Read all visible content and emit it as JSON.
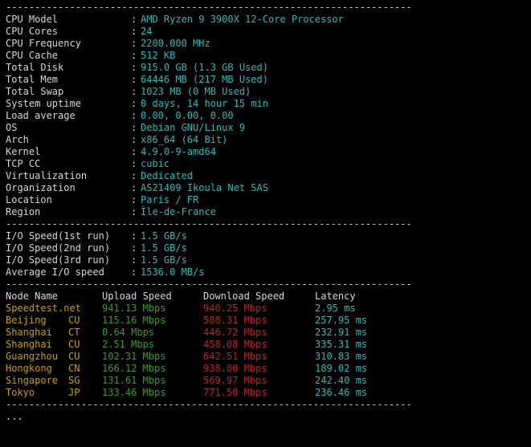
{
  "colors": {
    "label": "#d6d6d6",
    "value": "#2cb9b6",
    "node": "#c9a000",
    "upload": "#3b9a28",
    "download": "#c02020",
    "latency": "#2cb9b6"
  },
  "separator": "----------------------------------------------------------------------",
  "system_info": [
    {
      "label": "CPU Model",
      "value": "AMD Ryzen 9 3900X 12-Core Processor"
    },
    {
      "label": "CPU Cores",
      "value": "24"
    },
    {
      "label": "CPU Frequency",
      "value": "2200.000 MHz"
    },
    {
      "label": "CPU Cache",
      "value": "512 KB"
    },
    {
      "label": "Total Disk",
      "value": "915.0 GB (1.3 GB Used)"
    },
    {
      "label": "Total Mem",
      "value": "64446 MB (217 MB Used)"
    },
    {
      "label": "Total Swap",
      "value": "1023 MB (0 MB Used)"
    },
    {
      "label": "System uptime",
      "value": "0 days, 14 hour 15 min"
    },
    {
      "label": "Load average",
      "value": "0.00, 0.00, 0.00"
    },
    {
      "label": "OS",
      "value": "Debian GNU/Linux 9"
    },
    {
      "label": "Arch",
      "value": "x86_64 (64 Bit)"
    },
    {
      "label": "Kernel",
      "value": "4.9.0-9-amd64"
    },
    {
      "label": "TCP CC",
      "value": "cubic"
    },
    {
      "label": "Virtualization",
      "value": "Dedicated"
    },
    {
      "label": "Organization",
      "value": "AS21409 Ikoula Net SAS"
    },
    {
      "label": "Location",
      "value": "Paris / FR"
    },
    {
      "label": "Region",
      "value": "Île-de-France"
    }
  ],
  "io_speed": [
    {
      "label": "I/O Speed(1st run)",
      "value": "1.5 GB/s"
    },
    {
      "label": "I/O Speed(2nd run)",
      "value": "1.5 GB/s"
    },
    {
      "label": "I/O Speed(3rd run)",
      "value": "1.5 GB/s"
    },
    {
      "label": "Average I/O speed",
      "value": "1536.0 MB/s"
    }
  ],
  "speedtest": {
    "headers": {
      "node": "Node Name",
      "upload": "Upload Speed",
      "download": "Download Speed",
      "latency": "Latency"
    },
    "rows": [
      {
        "node": "Speedtest.net",
        "isp": "",
        "upload": "941.13 Mbps",
        "download": "940.25 Mbps",
        "latency": "2.95 ms"
      },
      {
        "node": "Beijing",
        "isp": "CU",
        "upload": "115.16 Mbps",
        "download": "588.31 Mbps",
        "latency": "257.95 ms"
      },
      {
        "node": "Shanghai",
        "isp": "CT",
        "upload": "0.64 Mbps",
        "download": "446.72 Mbps",
        "latency": "232.91 ms"
      },
      {
        "node": "Shanghai",
        "isp": "CU",
        "upload": "2.51 Mbps",
        "download": "458.08 Mbps",
        "latency": "335.31 ms"
      },
      {
        "node": "Guangzhou",
        "isp": "CU",
        "upload": "102.31 Mbps",
        "download": "642.51 Mbps",
        "latency": "310.83 ms"
      },
      {
        "node": "Hongkong",
        "isp": "CN",
        "upload": "166.12 Mbps",
        "download": "938.00 Mbps",
        "latency": "189.02 ms"
      },
      {
        "node": "Singapore",
        "isp": "SG",
        "upload": "131.61 Mbps",
        "download": "569.97 Mbps",
        "latency": "242.40 ms"
      },
      {
        "node": "Tokyo",
        "isp": "JP",
        "upload": "133.46 Mbps",
        "download": "771.50 Mbps",
        "latency": "236.46 ms"
      }
    ]
  },
  "prompt_text": "..."
}
